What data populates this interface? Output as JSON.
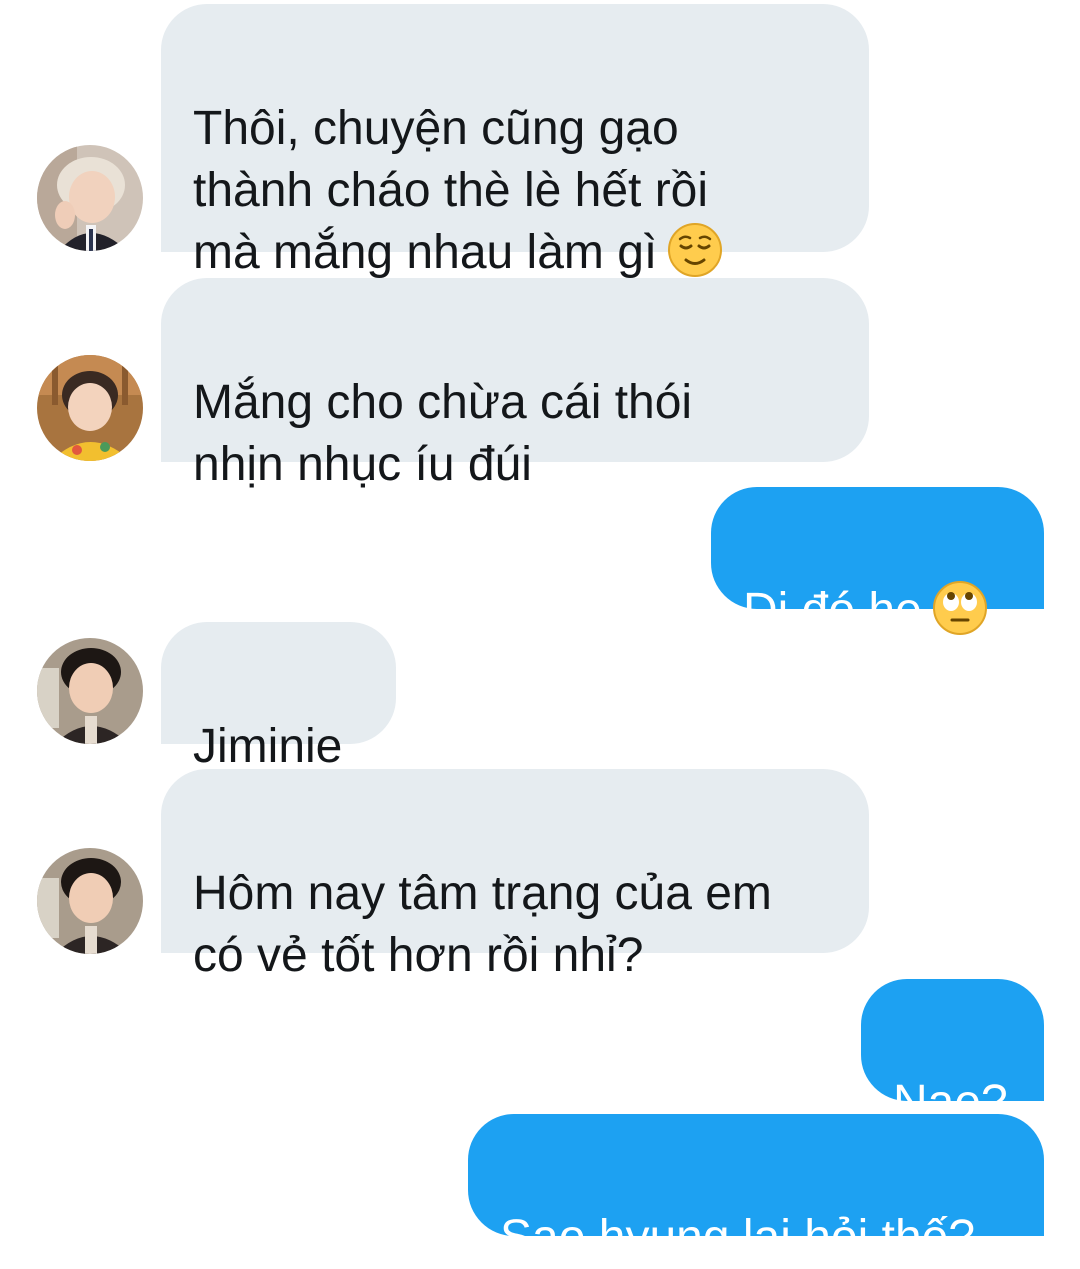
{
  "conversation": {
    "messages": [
      {
        "sender": "other",
        "avatar": "avatar-blond-hair",
        "text": "Thôi, chuyện cũng gạo\nthành cháo thè lè hết rồi\nmà mắng nhau làm gì",
        "emoji": "relieved-face-icon"
      },
      {
        "sender": "other",
        "avatar": "avatar-yellow-shirt",
        "text": "Mắng cho chừa cái thói\nnhịn nhục íu đúi"
      },
      {
        "sender": "me",
        "text": "Dị đó he",
        "emoji": "eye-roll-face-icon"
      },
      {
        "sender": "other",
        "avatar": "avatar-dark-hair",
        "text": "Jiminie"
      },
      {
        "sender": "other",
        "avatar": "avatar-dark-hair",
        "text": "Hôm nay tâm trạng của em\ncó vẻ tốt hơn rồi nhỉ?"
      },
      {
        "sender": "me",
        "text": "Nae?"
      },
      {
        "sender": "me",
        "text": "Sao hyung lại hỏi thế?"
      }
    ]
  },
  "colors": {
    "incoming_bubble": "#e6ecf0",
    "outgoing_bubble": "#1da1f2",
    "incoming_text": "#14171a",
    "outgoing_text": "#ffffff"
  }
}
